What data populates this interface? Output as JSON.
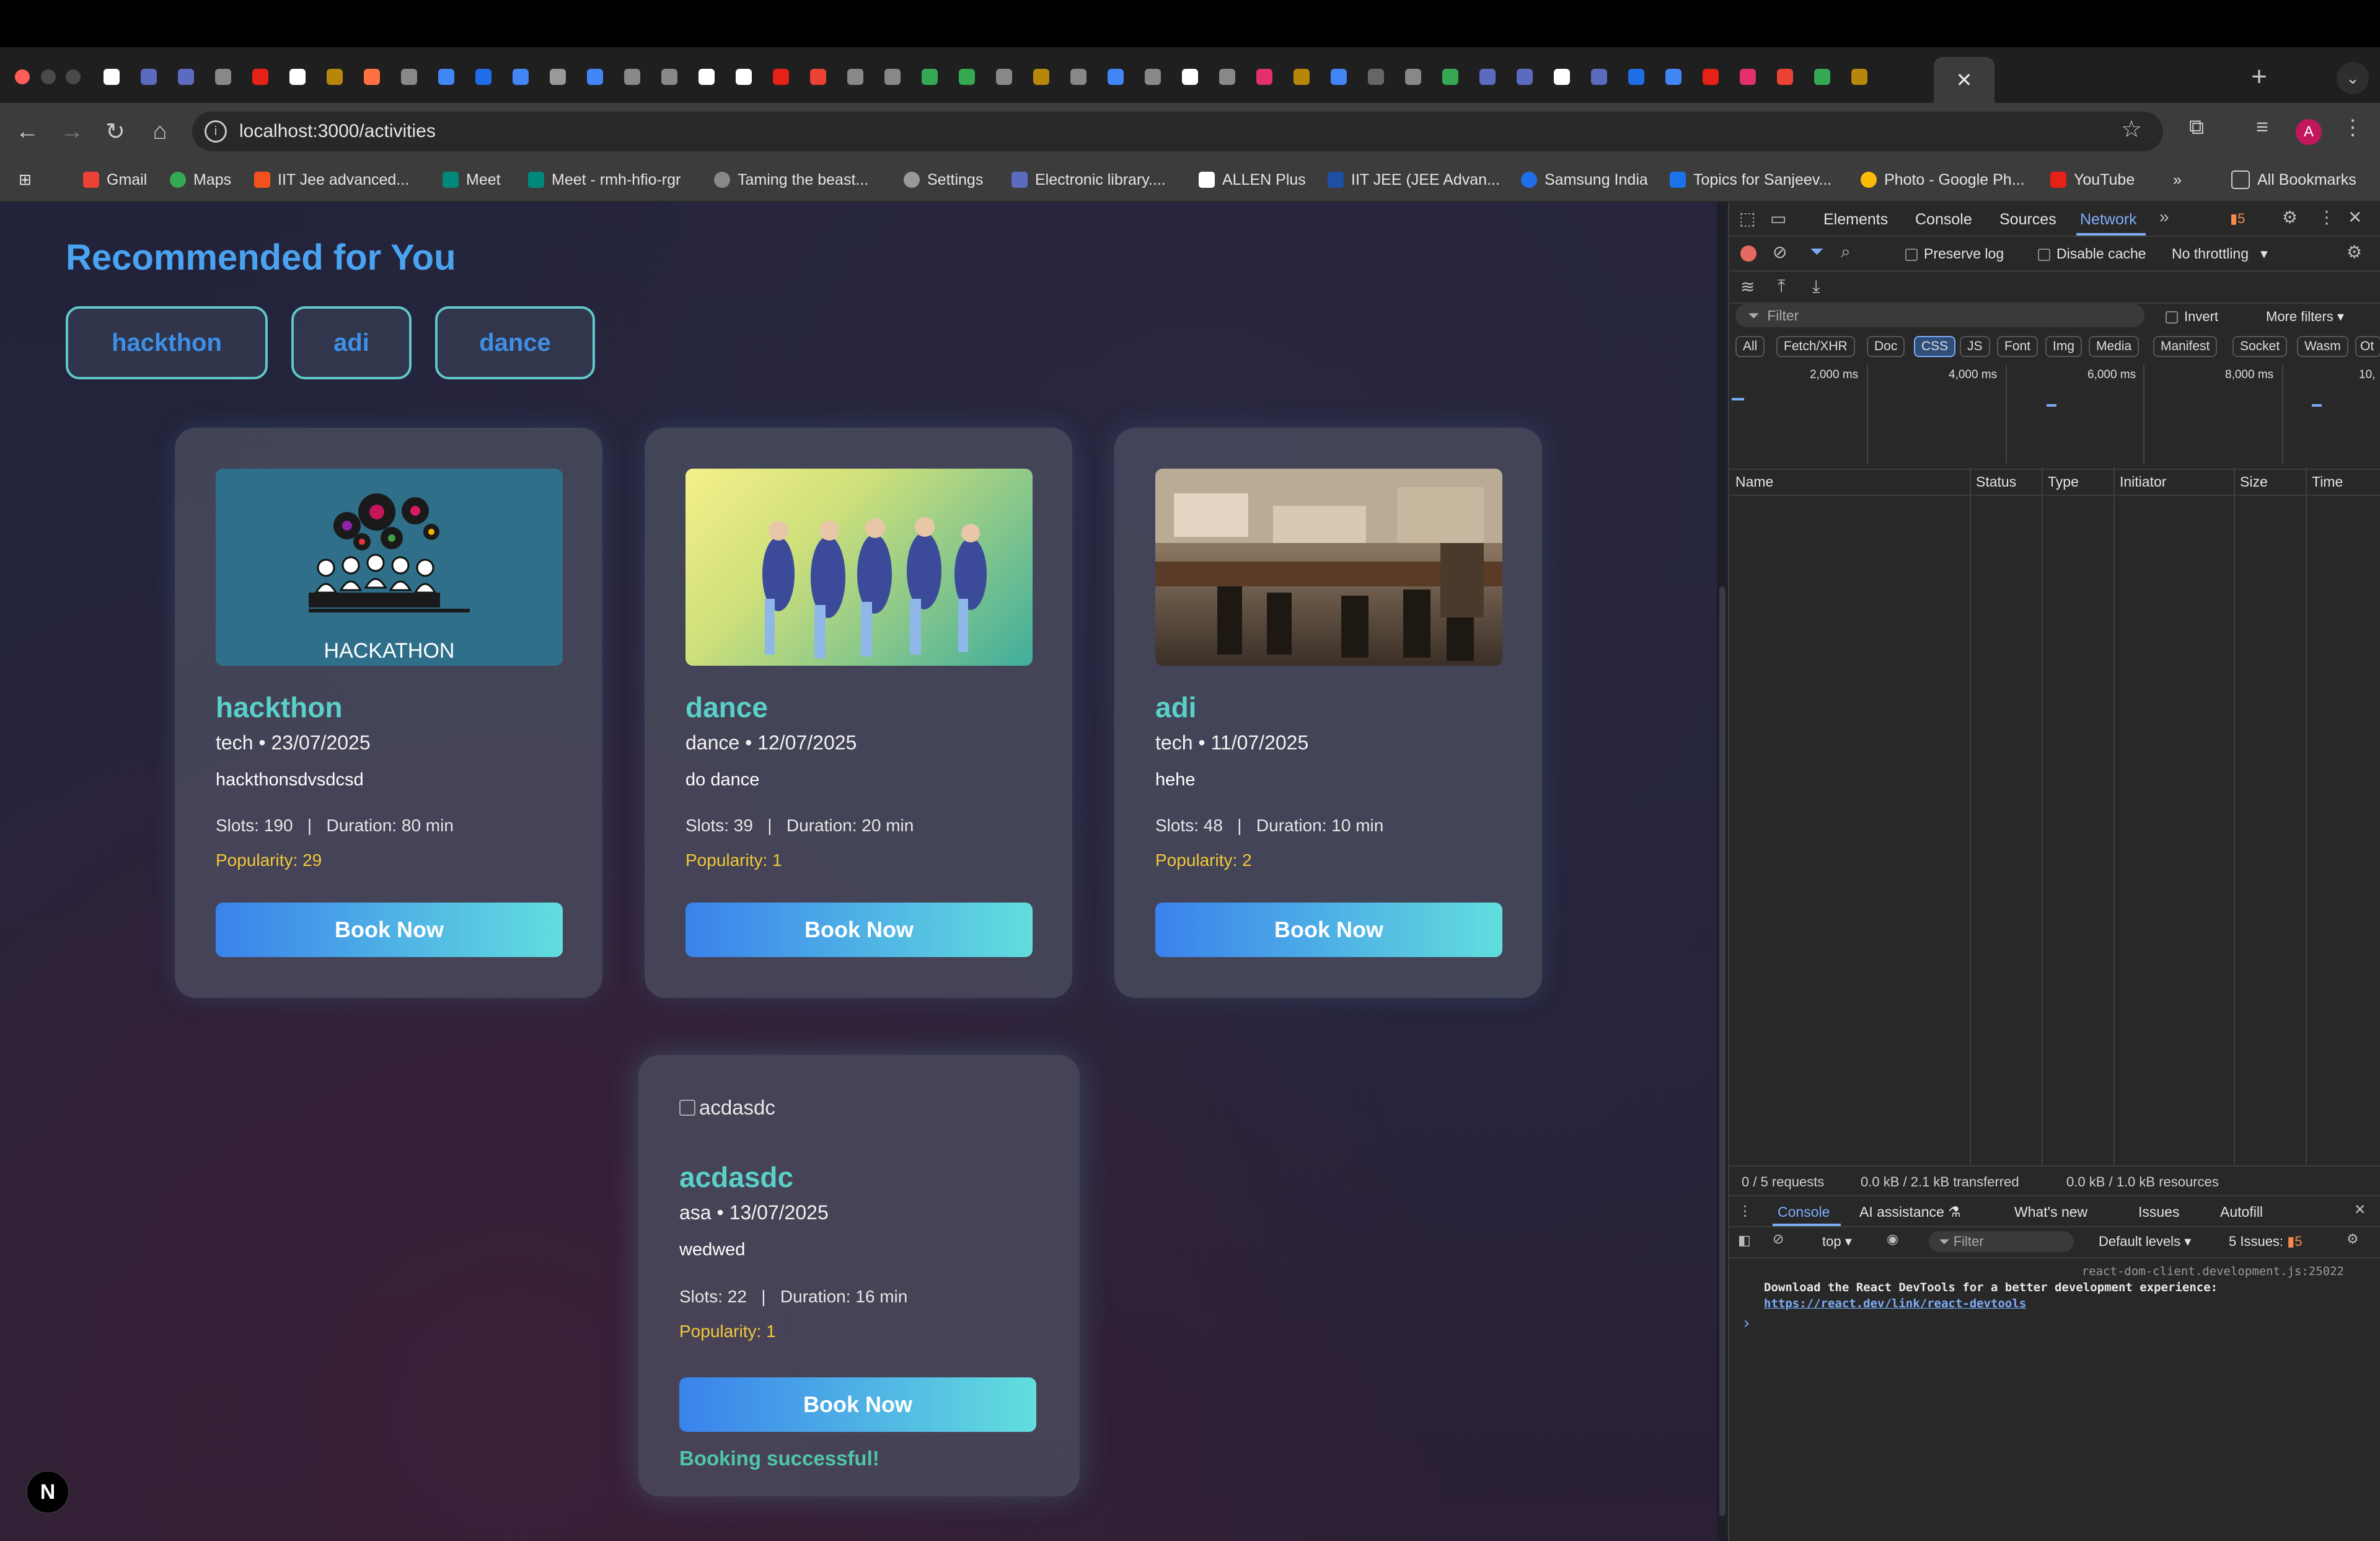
{
  "browser": {
    "url": "localhost:3000/activities",
    "avatar_letter": "A",
    "bookmarks": [
      "Gmail",
      "Maps",
      "IIT Jee advanced...",
      "Meet",
      "Meet - rmh-hfio-rgr",
      "Taming the beast...",
      "Settings",
      "Electronic library....",
      "ALLEN Plus",
      "IIT JEE (JEE Advan...",
      "Samsung India",
      "Topics for Sanjeev...",
      "Photo - Google Ph...",
      "YouTube"
    ],
    "all_bookmarks": "All Bookmarks",
    "more_bookmarks": "»"
  },
  "page": {
    "title": "Recommended for You",
    "chips": [
      "hackthon",
      "adi",
      "dance"
    ],
    "cards": [
      {
        "title": "hackthon",
        "meta": "tech • 23/07/2025",
        "desc": "hackthonsdvsdcsd",
        "slots": "Slots: 190   |   Duration: 80 min",
        "popularity": "Popularity: 29",
        "button": "Book Now",
        "image_caption": "HACKATHON"
      },
      {
        "title": "dance",
        "meta": "dance • 12/07/2025",
        "desc": "do dance",
        "slots": "Slots: 39   |   Duration: 20 min",
        "popularity": "Popularity: 1",
        "button": "Book Now"
      },
      {
        "title": "adi",
        "meta": "tech • 11/07/2025",
        "desc": "hehe",
        "slots": "Slots: 48   |   Duration: 10 min",
        "popularity": "Popularity: 2",
        "button": "Book Now"
      },
      {
        "title": "acdasdc",
        "meta": "asa • 13/07/2025",
        "desc": "wedwed",
        "slots": "Slots: 22   |   Duration: 16 min",
        "popularity": "Popularity: 1",
        "button": "Book Now",
        "broken_alt": "acdasdc",
        "success": "Booking successful!"
      }
    ],
    "next_badge": "N"
  },
  "devtools": {
    "tabs": [
      "Elements",
      "Console",
      "Sources",
      "Network"
    ],
    "active_tab": "Network",
    "issues_count": "5",
    "preserve_log": "Preserve log",
    "disable_cache": "Disable cache",
    "throttling": "No throttling",
    "filter_placeholder": "Filter",
    "invert": "Invert",
    "more_filters": "More filters",
    "type_filters": [
      "All",
      "Fetch/XHR",
      "Doc",
      "CSS",
      "JS",
      "Font",
      "Img",
      "Media",
      "Manifest",
      "Socket",
      "Wasm",
      "Ot"
    ],
    "active_type": "CSS",
    "timeline_ticks": [
      "2,000 ms",
      "4,000 ms",
      "6,000 ms",
      "8,000 ms",
      "10,"
    ],
    "columns": [
      "Name",
      "Status",
      "Type",
      "Initiator",
      "Size",
      "Time"
    ],
    "summary": [
      "0 / 5 requests",
      "0.0 kB / 2.1 kB transferred",
      "0.0 kB / 1.0 kB resources"
    ],
    "drawer_tabs": [
      "Console",
      "AI assistance",
      "What's new",
      "Issues",
      "Autofill"
    ],
    "console_context": "top",
    "console_filter": "Filter",
    "default_levels": "Default levels",
    "issues_label": "5 Issues:",
    "issues_badge": "5",
    "console_source": "react-dom-client.development.js:25022",
    "console_message": "Download the React DevTools for a better development experience:",
    "console_link": "https://react.dev/link/react-devtools",
    "console_prompt": "›"
  },
  "colors": {
    "accent_title": "#4aa3f0",
    "card_title": "#5ad0c8",
    "popularity": "#f3c83a",
    "success": "#4fc6a8",
    "devtools_active": "#7cacf8"
  }
}
